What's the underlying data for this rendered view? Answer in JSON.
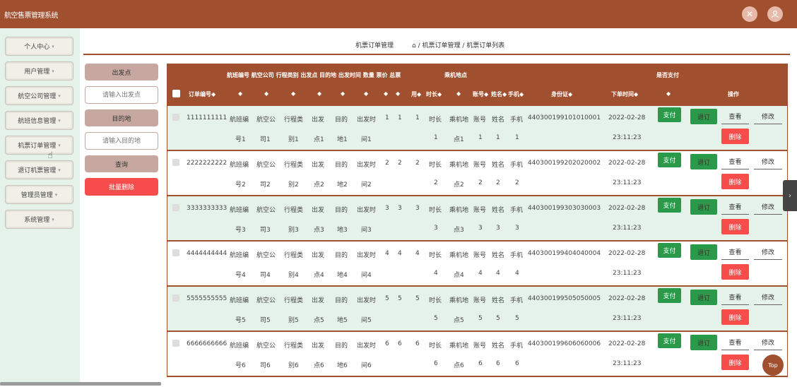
{
  "app": {
    "title": "航空售票管理系统"
  },
  "header_icons": [
    "fullscreen-icon",
    "user-avatar-icon"
  ],
  "sidebar": {
    "items": [
      {
        "label": "个人中心"
      },
      {
        "label": "用户管理"
      },
      {
        "label": "航空公司管理"
      },
      {
        "label": "航班信息管理"
      },
      {
        "label": "机票订单管理"
      },
      {
        "label": "退订机票管理"
      },
      {
        "label": "管理员管理"
      },
      {
        "label": "系统管理"
      }
    ],
    "arrow": "▾"
  },
  "breadcrumb": {
    "title": "机票订单管理",
    "path": "⌂ / 机票订单管理 / 机票订单列表"
  },
  "filters": {
    "departure_label": "出发点",
    "departure_placeholder": "请输入出发点",
    "destination_label": "目的地",
    "destination_placeholder": "请输入目的地",
    "query_button": "查询",
    "batch_delete_button": "批量删除"
  },
  "table": {
    "header_top": "航班编号 航空公司 行程类别 出发点 目的地 出发时间 数量 票价 总票",
    "header_boarding": "乘机地点",
    "header_paid": "是否支付",
    "col_order_no": "订单编号◆",
    "sort_marks": [
      "◆",
      "◆",
      "◆",
      "◆",
      "◆",
      "◆",
      "◆",
      "◆",
      "用◆",
      "时长◆",
      "◆",
      "账号◆",
      "姓名◆",
      "手机◆"
    ],
    "col_idcard": "身份证◆",
    "col_order_time": "下单时间◆",
    "col_paid_sort": "◆",
    "col_action": "操作",
    "rows": [
      {
        "order_no": "1111111111",
        "flight_a": "航班编",
        "flight_b": "号1",
        "airline_a": "航空公",
        "airline_b": "司1",
        "category_a": "行程类",
        "category_b": "别1",
        "from_a": "出发",
        "from_b": "点1",
        "to_a": "目的",
        "to_b": "地1",
        "dep_a": "出发时",
        "dep_b": "间1",
        "qty": "1",
        "price": "1",
        "total": "1",
        "dur_a": "时长",
        "dur_b": "1",
        "board_a": "乘机地",
        "board_b": "点1",
        "account_a": "账号",
        "account_b": "1",
        "name_a": "姓名",
        "name_b": "1",
        "phone_a": "手机",
        "phone_b": "1",
        "idcard": "440300199101010001",
        "date": "2022-02-28",
        "time": "23:11:23"
      },
      {
        "order_no": "2222222222",
        "flight_a": "航班编",
        "flight_b": "号2",
        "airline_a": "航空公",
        "airline_b": "司2",
        "category_a": "行程类",
        "category_b": "别2",
        "from_a": "出发",
        "from_b": "点2",
        "to_a": "目的",
        "to_b": "地2",
        "dep_a": "出发时",
        "dep_b": "间2",
        "qty": "2",
        "price": "2",
        "total": "2",
        "dur_a": "时长",
        "dur_b": "2",
        "board_a": "乘机地",
        "board_b": "点2",
        "account_a": "账号",
        "account_b": "2",
        "name_a": "姓名",
        "name_b": "2",
        "phone_a": "手机",
        "phone_b": "2",
        "idcard": "440300199202020002",
        "date": "2022-02-28",
        "time": "23:11:23"
      },
      {
        "order_no": "3333333333",
        "flight_a": "航班编",
        "flight_b": "号3",
        "airline_a": "航空公",
        "airline_b": "司3",
        "category_a": "行程类",
        "category_b": "别3",
        "from_a": "出发",
        "from_b": "点3",
        "to_a": "目的",
        "to_b": "地3",
        "dep_a": "出发时",
        "dep_b": "间3",
        "qty": "3",
        "price": "3",
        "total": "3",
        "dur_a": "时长",
        "dur_b": "3",
        "board_a": "乘机地",
        "board_b": "点3",
        "account_a": "账号",
        "account_b": "3",
        "name_a": "姓名",
        "name_b": "3",
        "phone_a": "手机",
        "phone_b": "3",
        "idcard": "440300199303030003",
        "date": "2022-02-28",
        "time": "23:11:23"
      },
      {
        "order_no": "4444444444",
        "flight_a": "航班编",
        "flight_b": "号4",
        "airline_a": "航空公",
        "airline_b": "司4",
        "category_a": "行程类",
        "category_b": "别4",
        "from_a": "出发",
        "from_b": "点4",
        "to_a": "目的",
        "to_b": "地4",
        "dep_a": "出发时",
        "dep_b": "间4",
        "qty": "4",
        "price": "4",
        "total": "4",
        "dur_a": "时长",
        "dur_b": "4",
        "board_a": "乘机地",
        "board_b": "点4",
        "account_a": "账号",
        "account_b": "4",
        "name_a": "姓名",
        "name_b": "4",
        "phone_a": "手机",
        "phone_b": "4",
        "idcard": "440300199404040004",
        "date": "2022-02-28",
        "time": "23:11:23"
      },
      {
        "order_no": "5555555555",
        "flight_a": "航班编",
        "flight_b": "号5",
        "airline_a": "航空公",
        "airline_b": "司5",
        "category_a": "行程类",
        "category_b": "别5",
        "from_a": "出发",
        "from_b": "点5",
        "to_a": "目的",
        "to_b": "地5",
        "dep_a": "出发时",
        "dep_b": "间5",
        "qty": "5",
        "price": "5",
        "total": "5",
        "dur_a": "时长",
        "dur_b": "5",
        "board_a": "乘机地",
        "board_b": "点5",
        "account_a": "账号",
        "account_b": "5",
        "name_a": "姓名",
        "name_b": "5",
        "phone_a": "手机",
        "phone_b": "5",
        "idcard": "440300199505050005",
        "date": "2022-02-28",
        "time": "23:11:23"
      },
      {
        "order_no": "6666666666",
        "flight_a": "航班编",
        "flight_b": "号6",
        "airline_a": "航空公",
        "airline_b": "司6",
        "category_a": "行程类",
        "category_b": "别6",
        "from_a": "出发",
        "from_b": "点6",
        "to_a": "目的",
        "to_b": "地6",
        "dep_a": "出发时",
        "dep_b": "间6",
        "qty": "6",
        "price": "6",
        "total": "6",
        "dur_a": "时长",
        "dur_b": "6",
        "board_a": "乘机地",
        "board_b": "点6",
        "account_a": "账号",
        "account_b": "6",
        "name_a": "姓名",
        "name_b": "6",
        "phone_a": "手机",
        "phone_b": "6",
        "idcard": "440300199606060006",
        "date": "2022-02-28",
        "time": "23:11:23"
      }
    ],
    "actions": {
      "pay": "支付",
      "refund": "退订",
      "view": "查看",
      "edit": "修改",
      "delete": "删除"
    }
  },
  "back_to_top": "Top",
  "colors": {
    "brand": "#a0502f",
    "sidebar_bg": "#e5f2ea",
    "danger": "#f64c4c",
    "success": "#2a9a4a",
    "filter_label": "#c7a8a0"
  }
}
